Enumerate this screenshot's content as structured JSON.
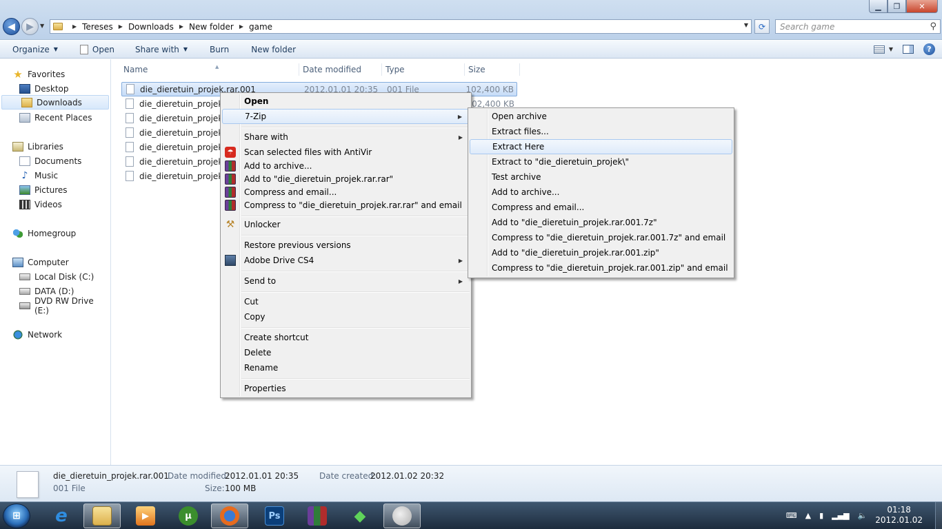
{
  "address": {
    "crumbs": [
      "Tereses",
      "Downloads",
      "New folder",
      "game"
    ],
    "search_placeholder": "Search game"
  },
  "toolbar": {
    "organize": "Organize",
    "open": "Open",
    "share_with": "Share with",
    "burn": "Burn",
    "new_folder": "New folder"
  },
  "nav": {
    "favorites": "Favorites",
    "desktop": "Desktop",
    "downloads": "Downloads",
    "recent_places": "Recent Places",
    "libraries": "Libraries",
    "documents": "Documents",
    "music": "Music",
    "pictures": "Pictures",
    "videos": "Videos",
    "homegroup": "Homegroup",
    "computer": "Computer",
    "local_disk": "Local Disk (C:)",
    "data_disk": "DATA (D:)",
    "dvd_drive": "DVD RW Drive (E:)",
    "network": "Network"
  },
  "columns": {
    "name": "Name",
    "date_modified": "Date modified",
    "type": "Type",
    "size": "Size"
  },
  "files": [
    {
      "name": "die_dieretuin_projek.rar.001",
      "date": "2012.01.01 20:35",
      "type": "001 File",
      "size": "102,400 KB"
    },
    {
      "name": "die_dieretuin_projek.rar.002",
      "date": "",
      "type": "",
      "size": "102,400 KB"
    },
    {
      "name": "die_dieretuin_projek.rar.003",
      "date": "",
      "type": "",
      "size": ""
    },
    {
      "name": "die_dieretuin_projek.rar.004",
      "date": "",
      "type": "",
      "size": ""
    },
    {
      "name": "die_dieretuin_projek.rar.005",
      "date": "",
      "type": "",
      "size": ""
    },
    {
      "name": "die_dieretuin_projek.rar.006",
      "date": "",
      "type": "",
      "size": ""
    },
    {
      "name": "die_dieretuin_projek.rar.007",
      "date": "",
      "type": "",
      "size": ""
    }
  ],
  "context_menu": {
    "open": "Open",
    "seven_zip": "7-Zip",
    "share_with": "Share with",
    "antivir": "Scan selected files with AntiVir",
    "add_archive": "Add to archive...",
    "add_rar": "Add to \"die_dieretuin_projek.rar.rar\"",
    "compress_email": "Compress and email...",
    "compress_rar_email": "Compress to \"die_dieretuin_projek.rar.rar\" and email",
    "unlocker": "Unlocker",
    "restore": "Restore previous versions",
    "adobe_drive": "Adobe Drive CS4",
    "send_to": "Send to",
    "cut": "Cut",
    "copy": "Copy",
    "create_shortcut": "Create shortcut",
    "delete": "Delete",
    "rename": "Rename",
    "properties": "Properties"
  },
  "submenu_7zip": {
    "open_archive": "Open archive",
    "extract_files": "Extract files...",
    "extract_here": "Extract Here",
    "extract_to": "Extract to \"die_dieretuin_projek\\\"",
    "test_archive": "Test archive",
    "add_archive": "Add to archive...",
    "compress_email": "Compress and email...",
    "add_7z": "Add to \"die_dieretuin_projek.rar.001.7z\"",
    "compress_7z_email": "Compress to \"die_dieretuin_projek.rar.001.7z\" and email",
    "add_zip": "Add to \"die_dieretuin_projek.rar.001.zip\"",
    "compress_zip_email": "Compress to \"die_dieretuin_projek.rar.001.zip\" and email"
  },
  "details": {
    "filename": "die_dieretuin_projek.rar.001",
    "filetype": "001 File",
    "date_modified_label": "Date modified:",
    "date_modified": "2012.01.01 20:35",
    "size_label": "Size:",
    "size": "100 MB",
    "date_created_label": "Date created:",
    "date_created": "2012.01.02 20:32"
  },
  "taskbar": {
    "time": "01:18",
    "date": "2012.01.02",
    "ps_label": "Ps"
  }
}
